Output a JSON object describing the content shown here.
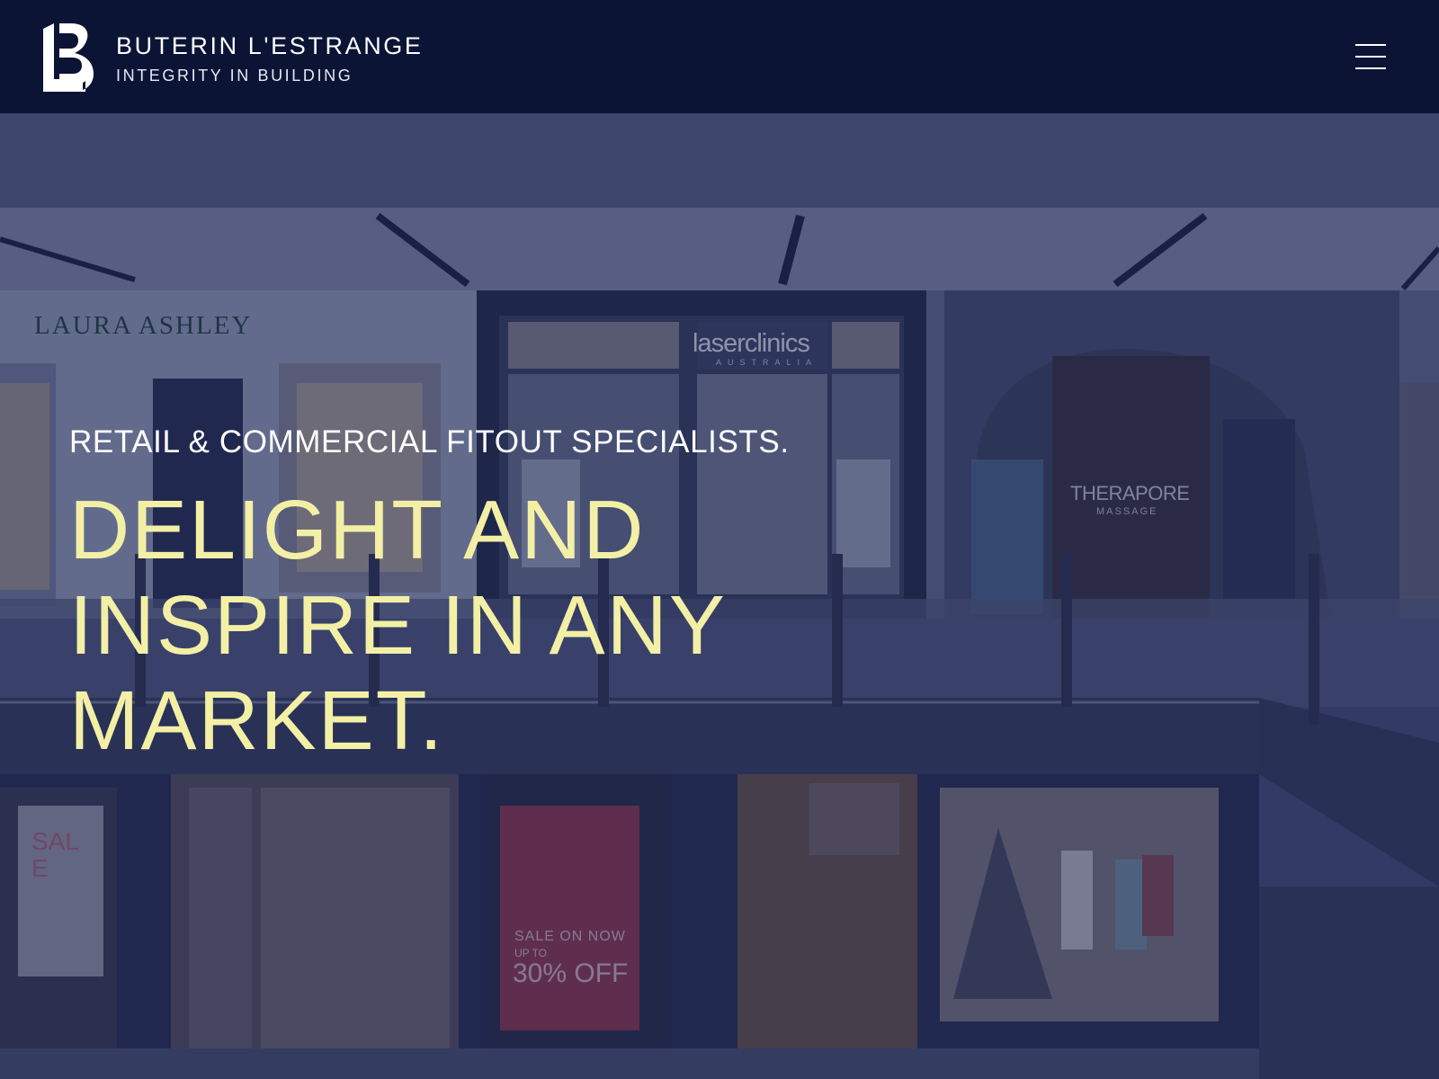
{
  "brand": {
    "name": "BUTERIN L'ESTRANGE",
    "tagline": "INTEGRITY IN BUILDING",
    "logo_icon": "lb-monogram-logo"
  },
  "nav": {
    "menu_icon": "hamburger-menu-icon"
  },
  "hero": {
    "kicker": "RETAIL & COMMERCIAL FITOUT SPECIALISTS.",
    "headline": "DELIGHT AND INSPIRE IN ANY MARKET.",
    "background_image": "shopping-centre-storefronts-photo",
    "storefront_signs": {
      "laura_ashley": "LAURA ASHLEY",
      "laser_clinics": "laserclinics",
      "laser_clinics_sub": "AUSTRALIA",
      "therapore": "THERAPORE",
      "therapore_sub": "MASSAGE",
      "sale_poster": "SALE",
      "sale_on_now": "SALE ON NOW",
      "up_to": "UP TO",
      "percent_off": "30% OFF"
    }
  },
  "colors": {
    "header_bg": "#0c1435",
    "accent_headline": "#f3f0a6",
    "overlay": "#161e4e",
    "text_light": "#ffffff"
  }
}
